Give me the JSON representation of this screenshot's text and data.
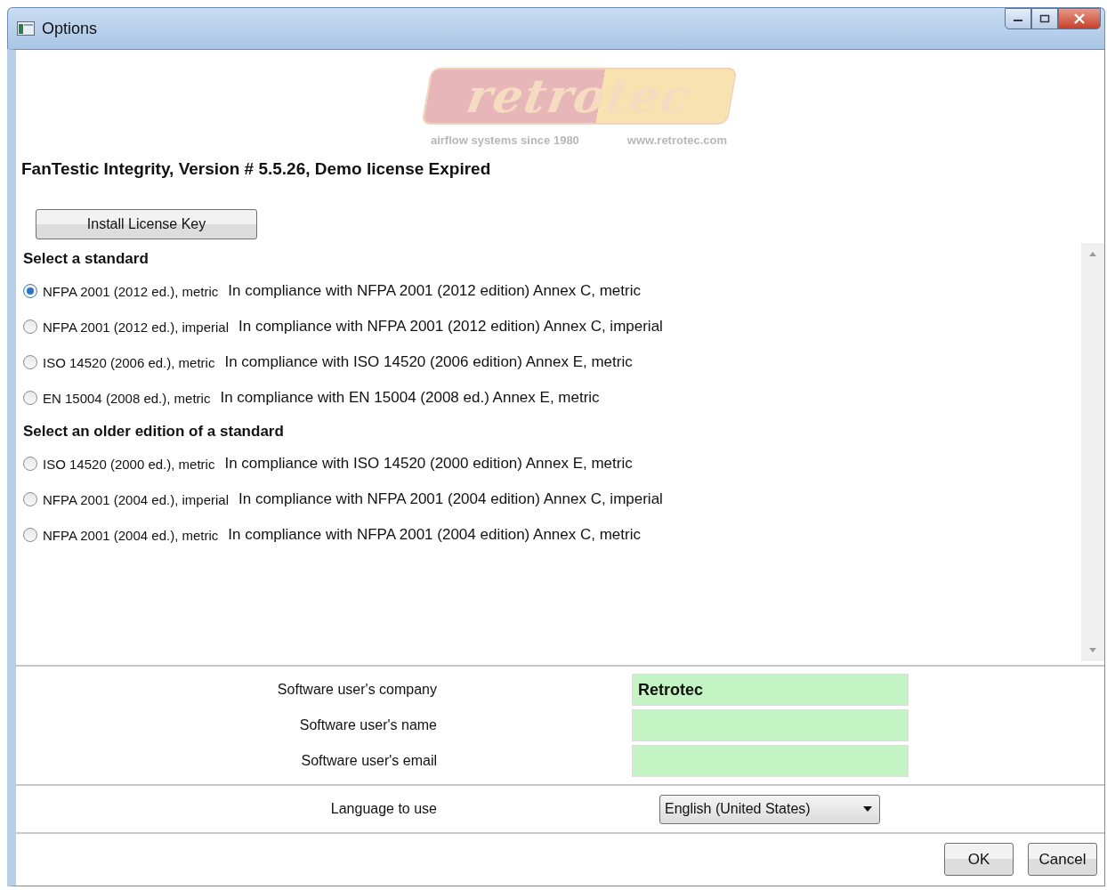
{
  "window": {
    "title": "Options"
  },
  "logo": {
    "wordmark": "retrotec",
    "tagline": "airflow systems since 1980",
    "url": "www.retrotec.com"
  },
  "heading": "FanTestic Integrity, Version # 5.5.26, Demo license Expired",
  "install_button": "Install License Key",
  "standard_groups": [
    {
      "title": "Select a standard",
      "options": [
        {
          "label": "NFPA 2001 (2012 ed.), metric",
          "description": "In compliance with NFPA 2001 (2012 edition) Annex C, metric",
          "selected": true
        },
        {
          "label": "NFPA 2001 (2012 ed.), imperial",
          "description": "In compliance with NFPA 2001 (2012 edition) Annex C, imperial",
          "selected": false
        },
        {
          "label": "ISO 14520 (2006 ed.), metric",
          "description": "In compliance with ISO 14520 (2006 edition) Annex E, metric",
          "selected": false
        },
        {
          "label": "EN 15004 (2008 ed.), metric",
          "description": "In compliance with EN 15004 (2008 ed.) Annex E, metric",
          "selected": false
        }
      ]
    },
    {
      "title": "Select an older edition of a standard",
      "options": [
        {
          "label": "ISO 14520 (2000 ed.), metric",
          "description": "In compliance with ISO 14520 (2000 edition) Annex E, metric",
          "selected": false
        },
        {
          "label": "NFPA 2001 (2004 ed.), imperial",
          "description": "In compliance with NFPA 2001 (2004 edition) Annex C, imperial",
          "selected": false
        },
        {
          "label": "NFPA 2001 (2004 ed.), metric",
          "description": "In compliance with NFPA 2001 (2004 edition) Annex C, metric",
          "selected": false
        }
      ]
    }
  ],
  "user_fields": [
    {
      "label": "Software user's company",
      "value": "Retrotec"
    },
    {
      "label": "Software user's name"
    },
    {
      "label": "Software user's email"
    }
  ],
  "language": {
    "label": "Language to use",
    "value": "English (United States)"
  },
  "buttons": [
    "OK",
    "Cancel"
  ]
}
